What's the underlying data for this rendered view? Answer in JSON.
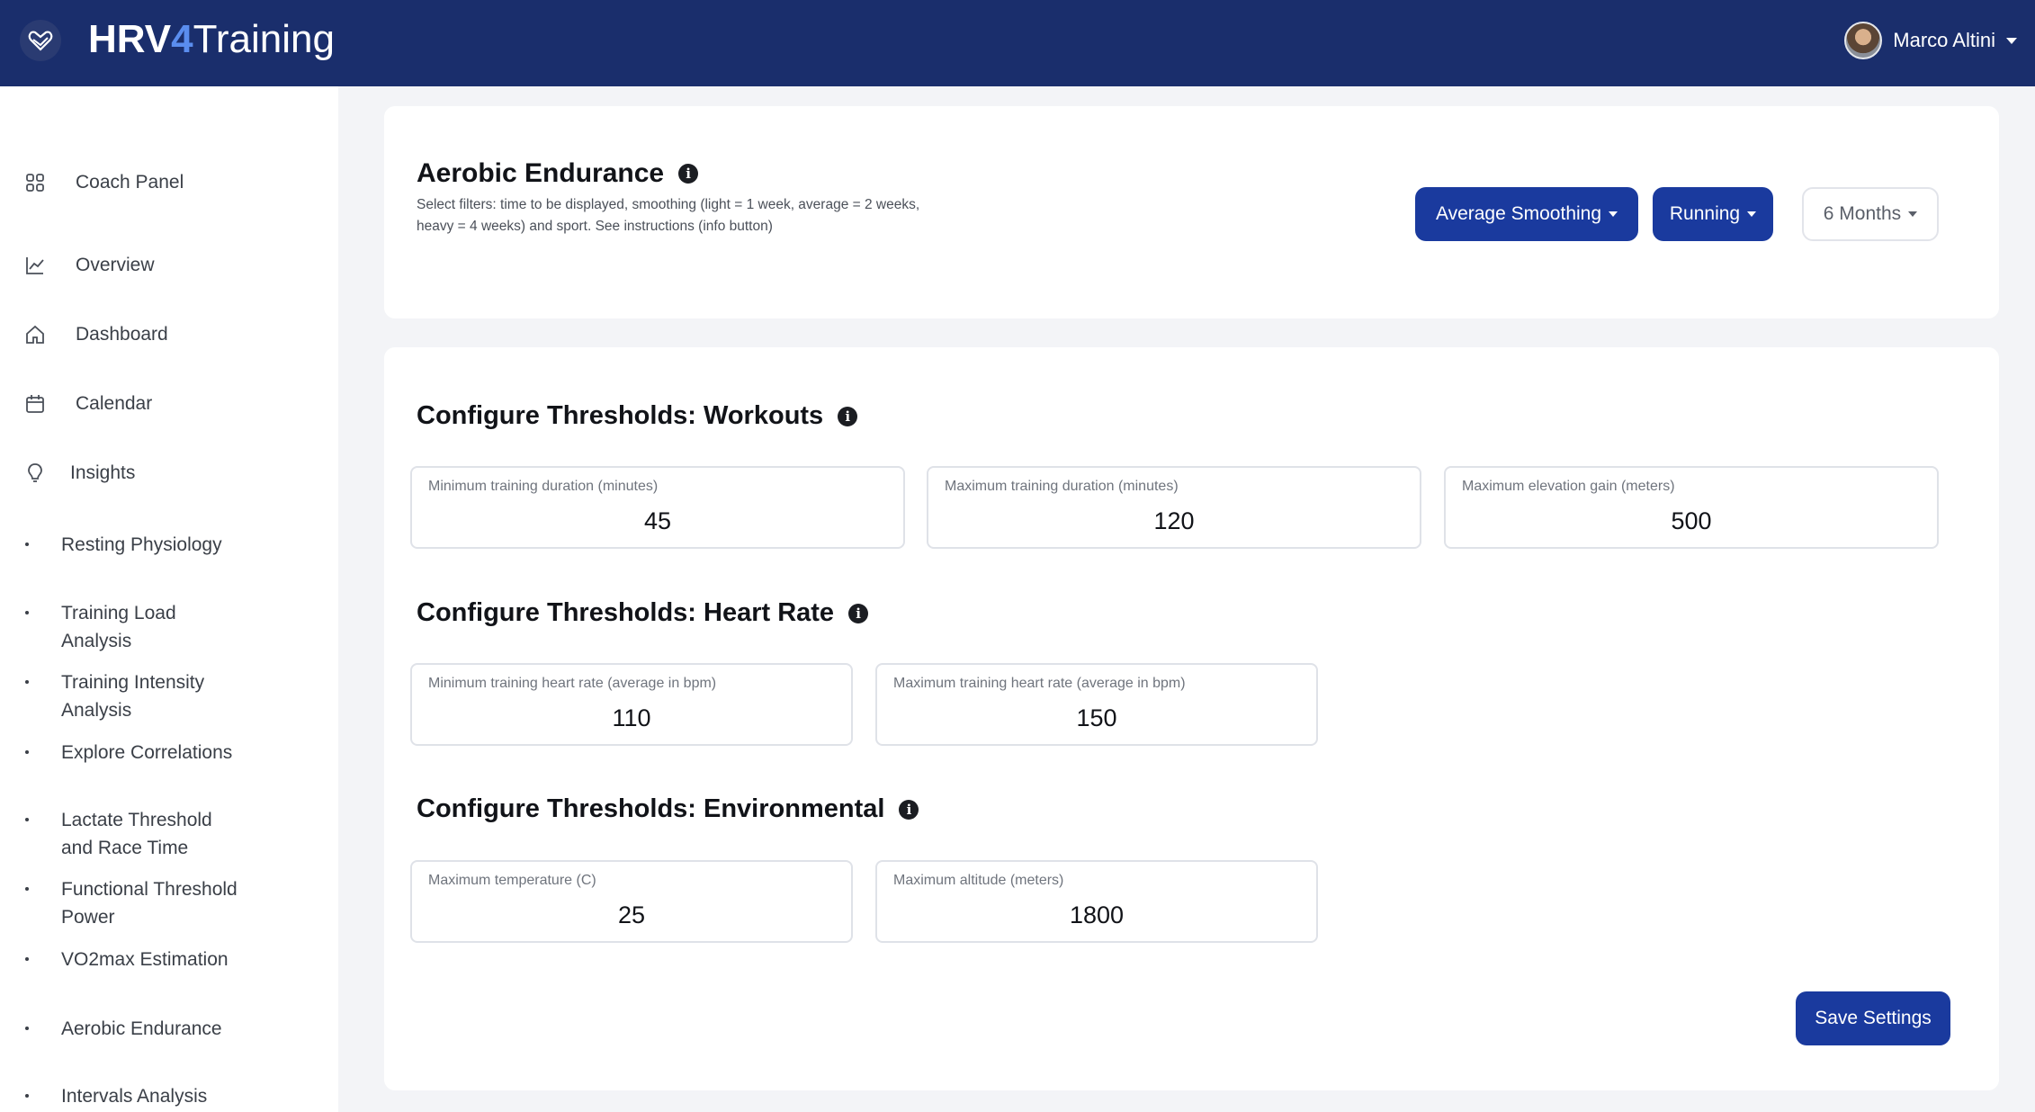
{
  "brand": {
    "part1": "HRV",
    "part2": "4",
    "part3": "Training",
    "logo_icon": "heart-hands-icon"
  },
  "user": {
    "name": "Marco Altini"
  },
  "sidebar": {
    "nav": [
      {
        "label": "Coach Panel",
        "icon": "grid-icon"
      },
      {
        "label": "Overview",
        "icon": "line-chart-icon"
      },
      {
        "label": "Dashboard",
        "icon": "home-icon"
      },
      {
        "label": "Calendar",
        "icon": "calendar-icon"
      },
      {
        "label": "Insights",
        "icon": "lightbulb-icon"
      }
    ],
    "sub": [
      {
        "label": "Resting Physiology"
      },
      {
        "label": "Training Load Analysis"
      },
      {
        "label": "Training Intensity Analysis"
      },
      {
        "label": "Explore Correlations"
      },
      {
        "label": "Lactate Threshold and Race Time"
      },
      {
        "label": "Functional Threshold Power"
      },
      {
        "label": "VO2max Estimation"
      },
      {
        "label": "Aerobic Endurance"
      },
      {
        "label": "Intervals Analysis"
      }
    ]
  },
  "header_card": {
    "title": "Aerobic Endurance",
    "description": "Select filters: time to be displayed, smoothing (light = 1 week, average = 2 weeks, heavy = 4 weeks) and sport. See instructions (info button)",
    "smoothing": "Average Smoothing",
    "sport": "Running",
    "period": "6 Months"
  },
  "workouts": {
    "title": "Configure Thresholds: Workouts",
    "fields": [
      {
        "label": "Minimum training duration (minutes)",
        "value": "45"
      },
      {
        "label": "Maximum training duration (minutes)",
        "value": "120"
      },
      {
        "label": "Maximum elevation gain (meters)",
        "value": "500"
      }
    ]
  },
  "heart_rate": {
    "title": "Configure Thresholds: Heart Rate",
    "fields": [
      {
        "label": "Minimum training heart rate (average in bpm)",
        "value": "110"
      },
      {
        "label": "Maximum training heart rate (average in bpm)",
        "value": "150"
      }
    ]
  },
  "environmental": {
    "title": "Configure Thresholds: Environmental",
    "fields": [
      {
        "label": "Maximum temperature (C)",
        "value": "25"
      },
      {
        "label": "Maximum altitude (meters)",
        "value": "1800"
      }
    ]
  },
  "save_label": "Save Settings",
  "colors": {
    "navbar": "#1a2e6c",
    "primary": "#1a3a9e",
    "background": "#f3f4f7"
  }
}
